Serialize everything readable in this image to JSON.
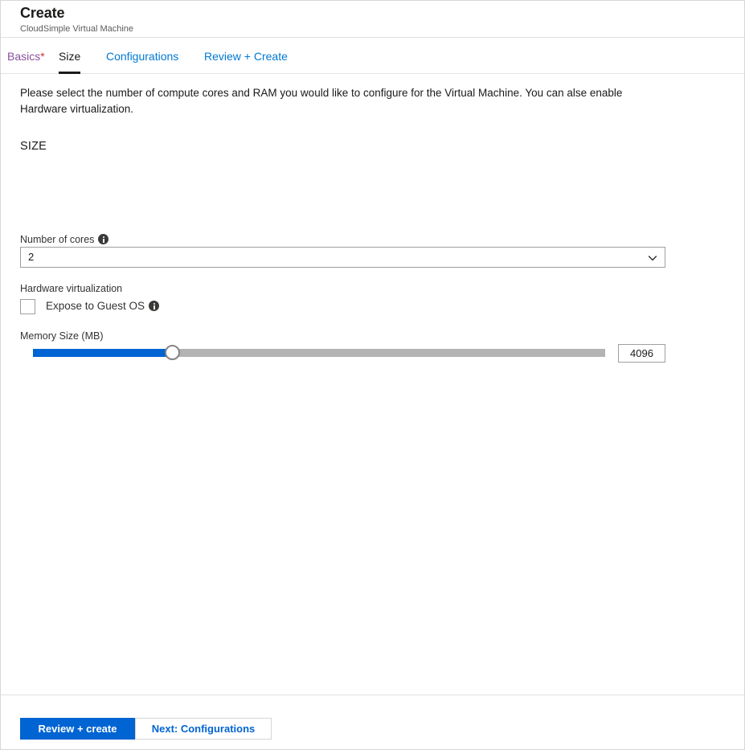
{
  "header": {
    "title": "Create",
    "subtitle": "CloudSimple Virtual Machine"
  },
  "tabs": [
    {
      "label": "Basics",
      "required_marker": "*",
      "state": "visited"
    },
    {
      "label": "Size",
      "state": "active"
    },
    {
      "label": "Configurations",
      "state": "link"
    },
    {
      "label": "Review + Create",
      "state": "link"
    }
  ],
  "main": {
    "intro": "Please select the number of compute cores and RAM you would like to configure for the Virtual Machine. You can alse enable Hardware virtualization.",
    "section_title": "SIZE",
    "cores": {
      "label": "Number of cores",
      "info_icon": "info-icon",
      "value": "2",
      "chevron_icon": "chevron-down-icon"
    },
    "hardware_virtualization": {
      "label": "Hardware virtualization",
      "checkbox_label": "Expose to Guest OS",
      "checked": false,
      "info_icon": "info-icon"
    },
    "memory": {
      "label": "Memory Size (MB)",
      "value": "4096",
      "min": 1024,
      "max": 16384,
      "fill_percent": 24.4
    }
  },
  "footer": {
    "primary_button": "Review + create",
    "secondary_button": "Next: Configurations"
  },
  "colors": {
    "accent": "#0064d2",
    "link": "#0078d4",
    "visited": "#8a4f9e",
    "required": "#d13438",
    "track": "#b3b3b3"
  }
}
